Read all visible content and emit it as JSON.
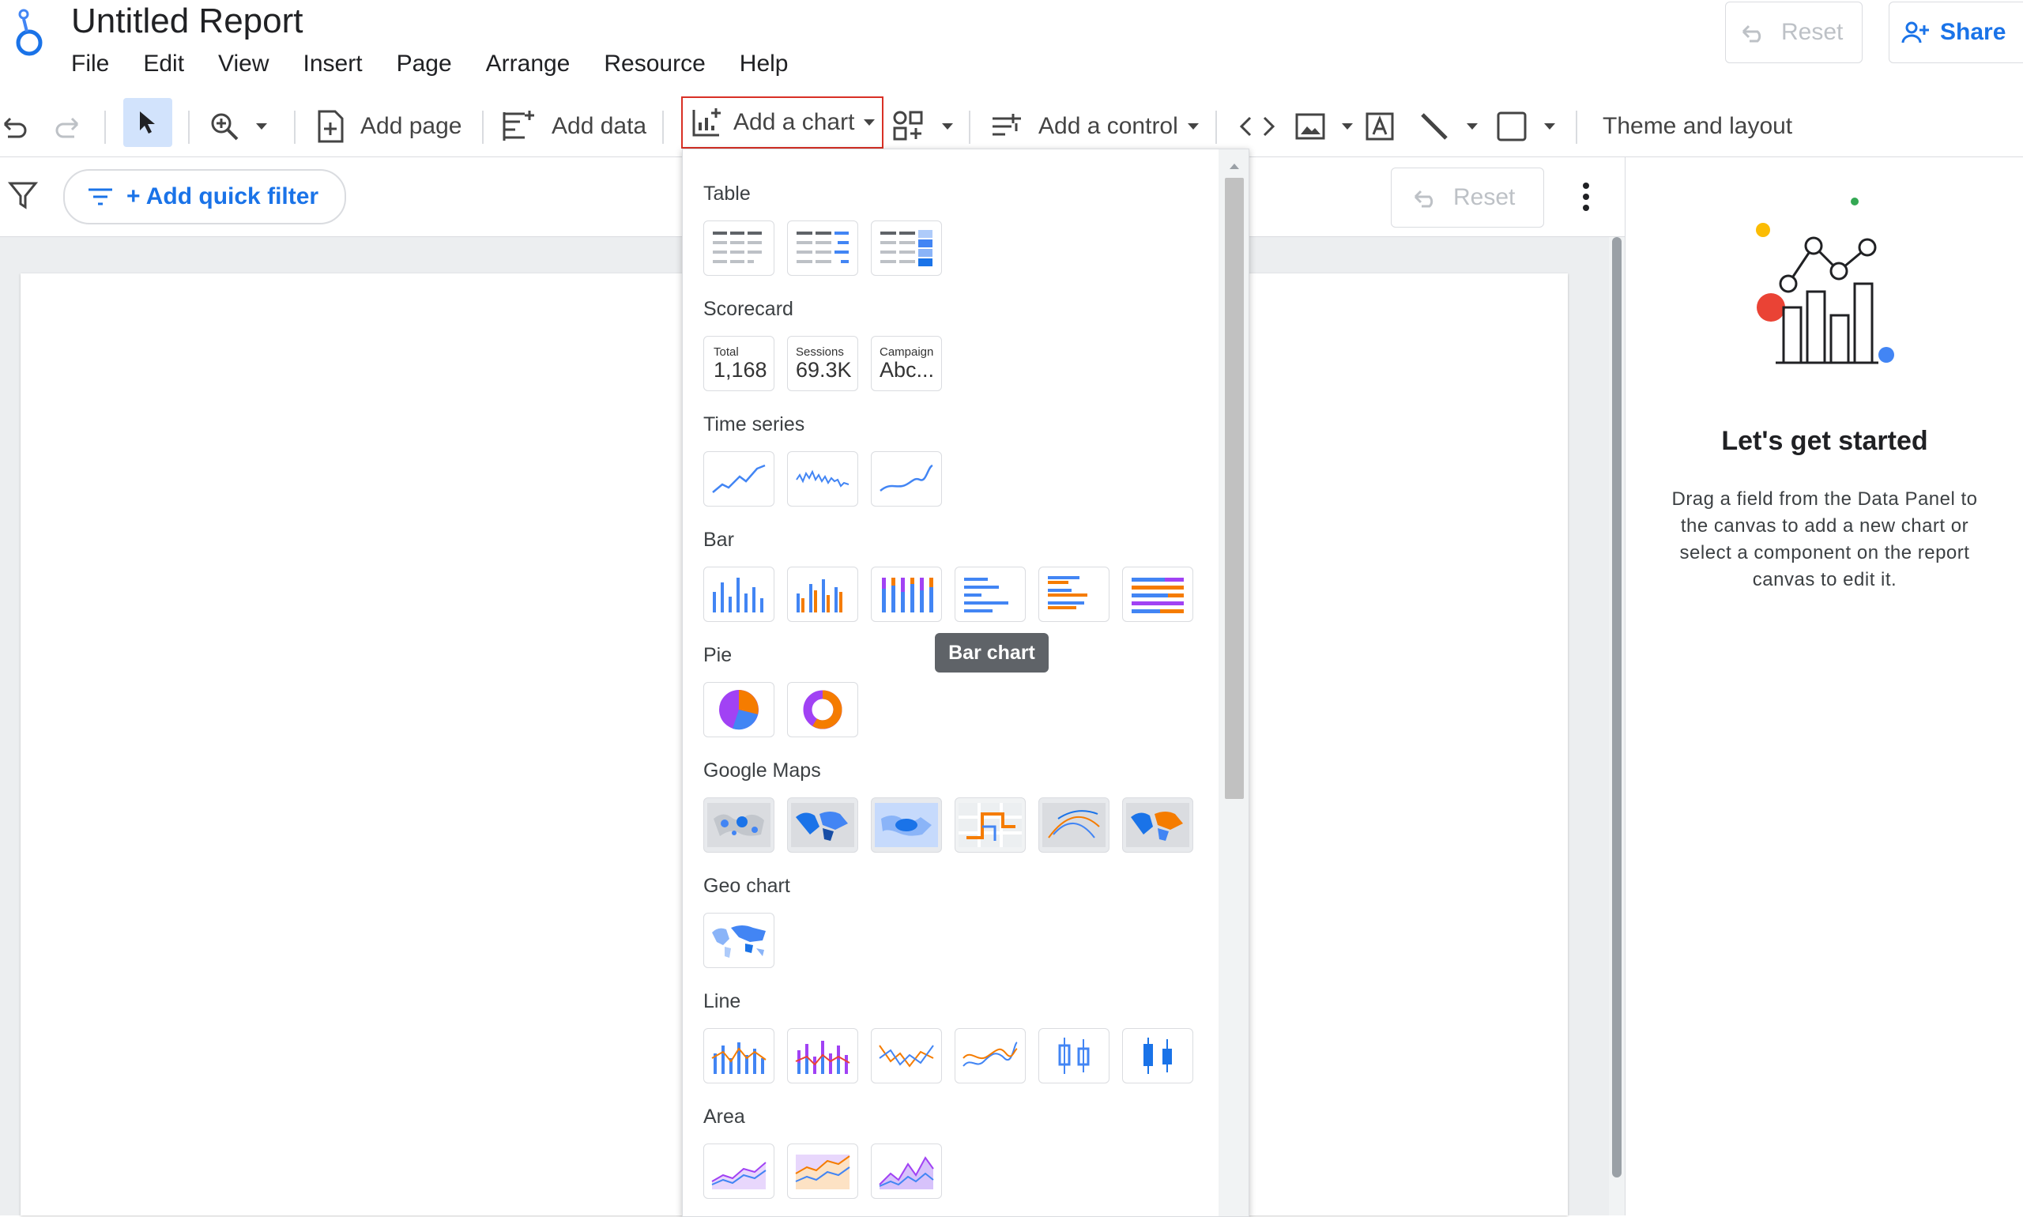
{
  "app": {
    "title": "Untitled Report",
    "menu": [
      "File",
      "Edit",
      "View",
      "Insert",
      "Page",
      "Arrange",
      "Resource",
      "Help"
    ],
    "reset_label": "Reset",
    "share_label": "Share"
  },
  "toolbar": {
    "add_page": "Add page",
    "add_data": "Add data",
    "add_chart": "Add a chart",
    "add_control": "Add a control",
    "theme_layout": "Theme and layout"
  },
  "filterbar": {
    "add_quick_filter": "+ Add quick filter",
    "reset_label": "Reset"
  },
  "chart_menu": {
    "sections": {
      "table": "Table",
      "scorecard": "Scorecard",
      "time_series": "Time series",
      "bar": "Bar",
      "pie": "Pie",
      "google_maps": "Google Maps",
      "geo_chart": "Geo chart",
      "line": "Line",
      "area": "Area"
    },
    "scorecards": [
      {
        "label": "Total",
        "value": "1,168"
      },
      {
        "label": "Sessions",
        "value": "69.3K"
      },
      {
        "label": "Campaign",
        "value": "Abc..."
      }
    ],
    "tooltip": "Bar chart"
  },
  "right_panel": {
    "heading": "Let's get started",
    "body_lines": [
      "Drag a field from the Data Panel to",
      "the canvas to add a new chart or",
      "select a component on the report",
      "canvas to edit it."
    ]
  },
  "colors": {
    "blue": "#4285f4",
    "orange": "#f57c00",
    "purple": "#a142f4",
    "accent": "#1a73e8",
    "highlight": "#d93025"
  }
}
